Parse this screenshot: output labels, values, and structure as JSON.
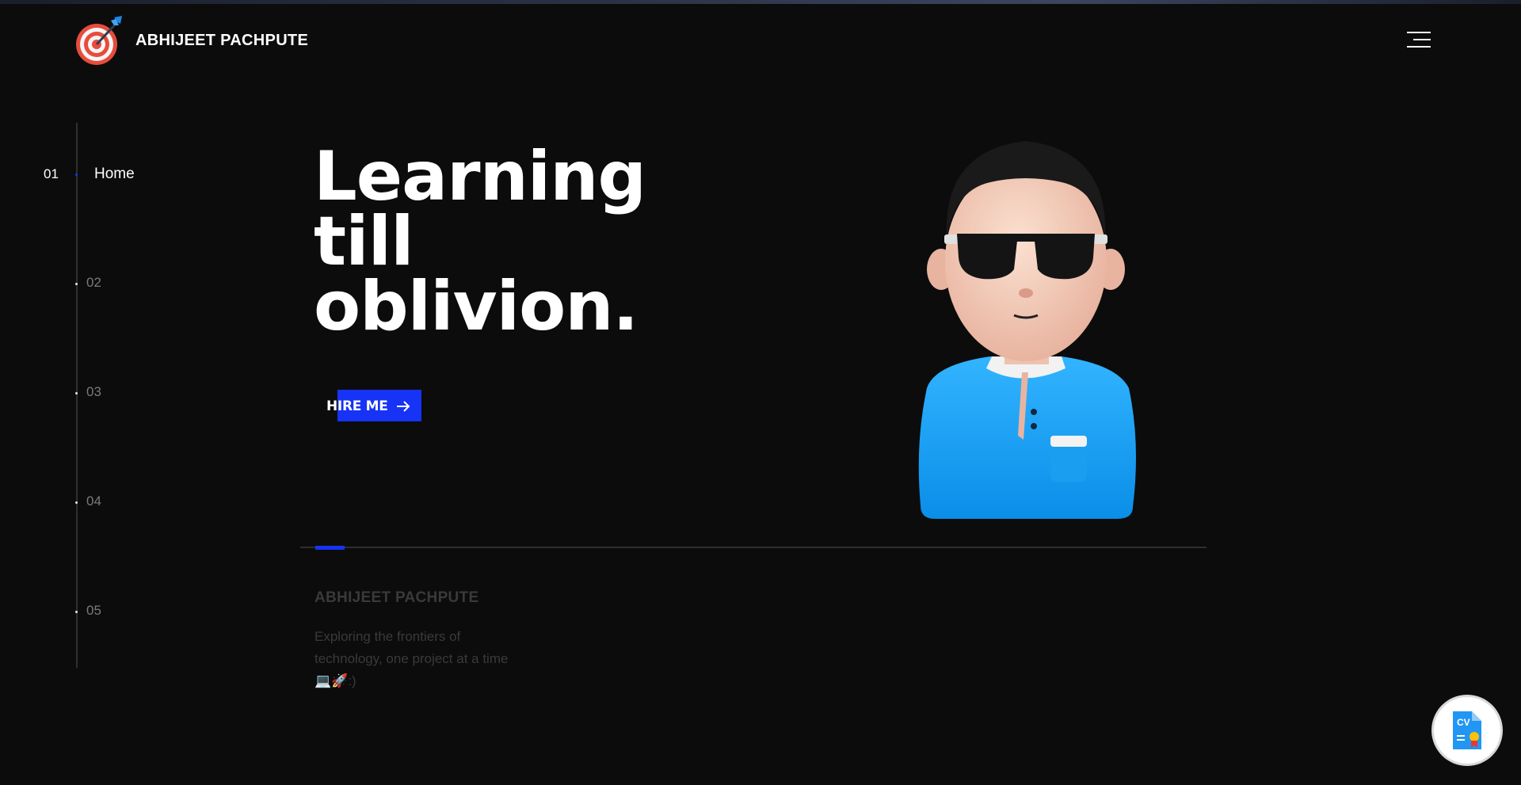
{
  "header": {
    "brand": "ABHIJEET PACHPUTE"
  },
  "sidenav": {
    "active_number": "01",
    "active_label": "Home",
    "items": [
      "02",
      "03",
      "04",
      "05"
    ]
  },
  "hero": {
    "headline_line1": "Learning",
    "headline_line2": "till",
    "headline_line3": "oblivion.",
    "hire_label": "HIRE ME"
  },
  "bio": {
    "name": "ABHIJEET PACHPUTE",
    "line1": "Exploring the frontiers of",
    "line2": "technology, one project at a time",
    "line3": "💻🚀:)"
  },
  "colors": {
    "accent": "#1733f5",
    "background": "#0c0c0c",
    "muted": "#3a3a3a"
  },
  "icons": [
    "target-logo-icon",
    "hamburger-menu-icon",
    "arrow-right-icon",
    "cv-document-icon"
  ]
}
